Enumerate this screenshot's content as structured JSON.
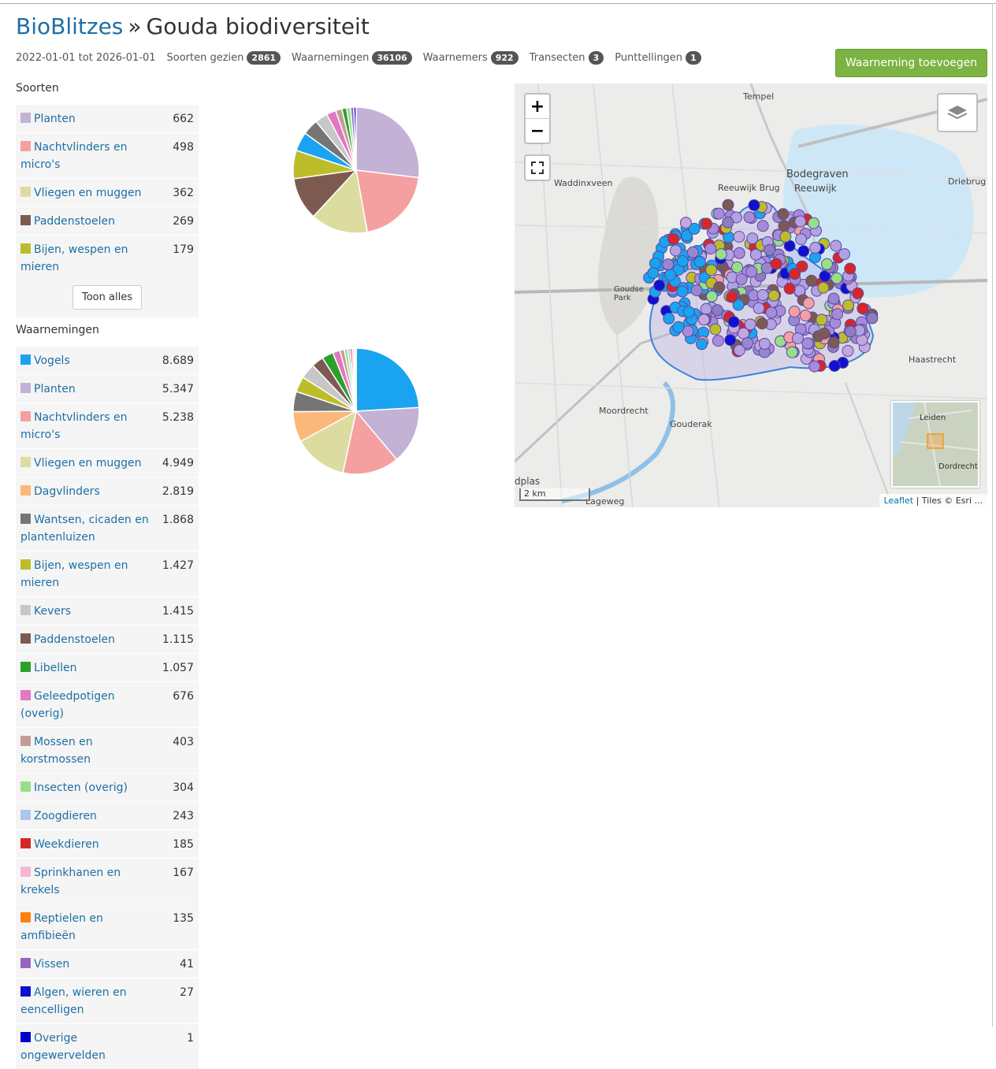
{
  "breadcrumb": {
    "root": "BioBlitzes",
    "separator": "»",
    "page": "Gouda biodiversiteit"
  },
  "stats": {
    "date_range": "2022-01-01 tot 2026-01-01",
    "items": [
      {
        "label": "Soorten gezien",
        "count": "2861"
      },
      {
        "label": "Waarnemingen",
        "count": "36106"
      },
      {
        "label": "Waarnemers",
        "count": "922"
      },
      {
        "label": "Transecten",
        "count": "3"
      },
      {
        "label": "Punttellingen",
        "count": "1"
      }
    ]
  },
  "add_button": "Waarneming toevoegen",
  "soorten": {
    "heading": "Soorten",
    "show_all": "Toon alles",
    "items": [
      {
        "label": "Planten",
        "value": "662",
        "color": "#c3b1d6"
      },
      {
        "label": "Nachtvlinders en micro's",
        "value": "498",
        "color": "#f5a0a0"
      },
      {
        "label": "Vliegen en muggen",
        "value": "362",
        "color": "#dcdca0"
      },
      {
        "label": "Paddenstoelen",
        "value": "269",
        "color": "#7d5a50"
      },
      {
        "label": "Bijen, wespen en mieren",
        "value": "179",
        "color": "#bdbd2a"
      }
    ]
  },
  "waarnemingen": {
    "heading": "Waarnemingen",
    "items": [
      {
        "label": "Vogels",
        "value": "8.689",
        "color": "#1aa3f0"
      },
      {
        "label": "Planten",
        "value": "5.347",
        "color": "#c3b1d6"
      },
      {
        "label": "Nachtvlinders en micro's",
        "value": "5.238",
        "color": "#f5a0a0"
      },
      {
        "label": "Vliegen en muggen",
        "value": "4.949",
        "color": "#dcdca0"
      },
      {
        "label": "Dagvlinders",
        "value": "2.819",
        "color": "#fbb87a"
      },
      {
        "label": "Wantsen, cicaden en plantenluizen",
        "value": "1.868",
        "color": "#757575"
      },
      {
        "label": "Bijen, wespen en mieren",
        "value": "1.427",
        "color": "#bdbd2a"
      },
      {
        "label": "Kevers",
        "value": "1.415",
        "color": "#c7c7c7"
      },
      {
        "label": "Paddenstoelen",
        "value": "1.115",
        "color": "#7d5a50"
      },
      {
        "label": "Libellen",
        "value": "1.057",
        "color": "#2ca02c"
      },
      {
        "label": "Geleedpotigen (overig)",
        "value": "676",
        "color": "#e377c2"
      },
      {
        "label": "Mossen en korstmossen",
        "value": "403",
        "color": "#c49c94"
      },
      {
        "label": "Insecten (overig)",
        "value": "304",
        "color": "#98df8a"
      },
      {
        "label": "Zoogdieren",
        "value": "243",
        "color": "#aec7e8"
      },
      {
        "label": "Weekdieren",
        "value": "185",
        "color": "#d62728"
      },
      {
        "label": "Sprinkhanen en krekels",
        "value": "167",
        "color": "#f7b6d2"
      },
      {
        "label": "Reptielen en amfibieën",
        "value": "135",
        "color": "#ff7f0e"
      },
      {
        "label": "Vissen",
        "value": "41",
        "color": "#9467bd"
      },
      {
        "label": "Algen, wieren en eencelligen",
        "value": "27",
        "color": "#1010d0"
      },
      {
        "label": "Overige ongewervelden",
        "value": "1",
        "color": "#0000cc"
      }
    ]
  },
  "pie_soorten": {
    "values": [
      662,
      498,
      362,
      269,
      179,
      120,
      100,
      80,
      60,
      40,
      30,
      25,
      20,
      15
    ],
    "colors": [
      "#c3b1d6",
      "#f5a0a0",
      "#dcdca0",
      "#7d5a50",
      "#bdbd2a",
      "#1aa3f0",
      "#757575",
      "#c7c7c7",
      "#e377c2",
      "#c49c94",
      "#2ca02c",
      "#98df8a",
      "#9467bd",
      "#1010d0"
    ]
  },
  "map": {
    "zoom_in": "+",
    "zoom_out": "−",
    "scale": "2 km",
    "attribution_link": "Leaflet",
    "attribution_text": "| Tiles © Esri ...",
    "labels": {
      "tempel": "Tempel",
      "waddinxveen": "Waddinxveen",
      "bodegraven": "Bodegraven",
      "reeuwijk_brug": "Reeuwijk Brug",
      "reeuwijk": "Reeuwijk",
      "driebrug": "Driebrug",
      "goudse_park": "Goudse Park",
      "haastrecht": "Haastrecht",
      "moordrecht": "Moordrecht",
      "gouderak": "Gouderak",
      "dplas": "dplas",
      "lageweg": "Lageweg",
      "leiden": "Leiden",
      "dordrecht": "Dordrecht"
    }
  }
}
